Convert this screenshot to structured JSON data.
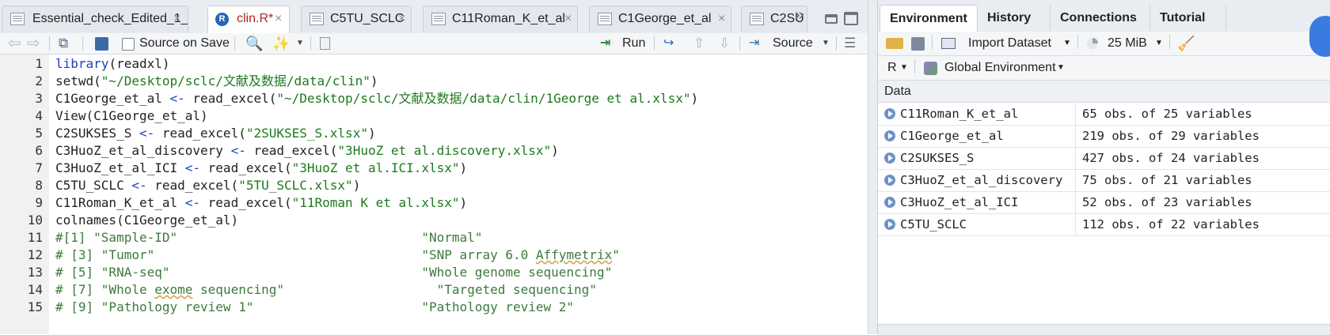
{
  "editor": {
    "tabs": [
      {
        "label": "Essential_check_Edited_1_",
        "icon": "document-icon",
        "active": false
      },
      {
        "label": "clin.R*",
        "icon": "r-script-icon",
        "active": true
      },
      {
        "label": "C5TU_SCLC",
        "icon": "document-icon",
        "active": false
      },
      {
        "label": "C11Roman_K_et_al",
        "icon": "document-icon",
        "active": false
      },
      {
        "label": "C1George_et_al",
        "icon": "document-icon",
        "active": false
      },
      {
        "label": "C2SU",
        "icon": "document-icon",
        "active": false
      }
    ],
    "toolbar": {
      "source_on_save": "Source on Save",
      "run": "Run",
      "source": "Source"
    },
    "lines": [
      {
        "n": "1",
        "parts": [
          [
            "kw",
            "library"
          ],
          [
            "",
            "(readxl)"
          ]
        ]
      },
      {
        "n": "2",
        "parts": [
          [
            "",
            "setwd("
          ],
          [
            "str",
            "\"~/Desktop/sclc/文献及数据/data/clin\""
          ],
          [
            "",
            ")"
          ]
        ]
      },
      {
        "n": "3",
        "parts": [
          [
            "",
            "C1George_et_al "
          ],
          [
            "op",
            "<-"
          ],
          [
            "",
            " read_excel("
          ],
          [
            "str",
            "\"~/Desktop/sclc/文献及数据/data/clin/1George et al.xlsx\""
          ],
          [
            "",
            ")"
          ]
        ]
      },
      {
        "n": "4",
        "parts": [
          [
            "",
            "View(C1George_et_al)"
          ]
        ]
      },
      {
        "n": "5",
        "parts": [
          [
            "",
            "C2SUKSES_S "
          ],
          [
            "op",
            "<-"
          ],
          [
            "",
            " read_excel("
          ],
          [
            "str",
            "\"2SUKSES_S.xlsx\""
          ],
          [
            "",
            ")"
          ]
        ]
      },
      {
        "n": "6",
        "parts": [
          [
            "",
            "C3HuoZ_et_al_discovery "
          ],
          [
            "op",
            "<-"
          ],
          [
            "",
            " read_excel("
          ],
          [
            "str",
            "\"3HuoZ et al.discovery.xlsx\""
          ],
          [
            "",
            ")"
          ]
        ]
      },
      {
        "n": "7",
        "parts": [
          [
            "",
            "C3HuoZ_et_al_ICI "
          ],
          [
            "op",
            "<-"
          ],
          [
            "",
            " read_excel("
          ],
          [
            "str",
            "\"3HuoZ et al.ICI.xlsx\""
          ],
          [
            "",
            ")"
          ]
        ]
      },
      {
        "n": "8",
        "parts": [
          [
            "",
            "C5TU_SCLC "
          ],
          [
            "op",
            "<-"
          ],
          [
            "",
            " read_excel("
          ],
          [
            "str",
            "\"5TU_SCLC.xlsx\""
          ],
          [
            "",
            ")"
          ]
        ]
      },
      {
        "n": "9",
        "parts": [
          [
            "",
            "C11Roman_K_et_al "
          ],
          [
            "op",
            "<-"
          ],
          [
            "",
            " read_excel("
          ],
          [
            "str",
            "\"11Roman K et al.xlsx\""
          ],
          [
            "",
            ")"
          ]
        ]
      },
      {
        "n": "10",
        "parts": [
          [
            "",
            "colnames(C1George_et_al)"
          ]
        ]
      },
      {
        "n": "11",
        "parts": [
          [
            "cm",
            "#[1] \"Sample-ID\"                                \"Normal\""
          ]
        ]
      },
      {
        "n": "12",
        "parts": [
          [
            "cm",
            "# [3] \"Tumor\"                                   \"SNP array 6.0 "
          ],
          [
            "cm sq",
            "Affymetrix"
          ],
          [
            "cm",
            "\""
          ]
        ]
      },
      {
        "n": "13",
        "parts": [
          [
            "cm",
            "# [5] \"RNA-seq\"                                 \"Whole genome sequencing\""
          ]
        ]
      },
      {
        "n": "14",
        "parts": [
          [
            "cm",
            "# [7] \"Whole "
          ],
          [
            "cm sq",
            "exome"
          ],
          [
            "cm",
            " sequencing\"                    \"Targeted sequencing\""
          ]
        ]
      },
      {
        "n": "15",
        "parts": [
          [
            "cm",
            "# [9] \"Pathology review 1\"                      \"Pathology review 2\""
          ]
        ]
      }
    ]
  },
  "env": {
    "tabs": [
      "Environment",
      "History",
      "Connections",
      "Tutorial"
    ],
    "import_dataset": "Import Dataset",
    "memory": "25 MiB",
    "language": "R",
    "scope": "Global Environment",
    "data_header": "Data",
    "rows": [
      {
        "name": "C11Roman_K_et_al",
        "value": "65 obs. of 25 variables"
      },
      {
        "name": "C1George_et_al",
        "value": "219 obs. of 29 variables"
      },
      {
        "name": "C2SUKSES_S",
        "value": "427 obs. of 24 variables"
      },
      {
        "name": "C3HuoZ_et_al_discovery",
        "value": "75 obs. of 21 variables"
      },
      {
        "name": "C3HuoZ_et_al_ICI",
        "value": "52 obs. of 23 variables"
      },
      {
        "name": "C5TU_SCLC",
        "value": "112 obs. of 22 variables"
      }
    ]
  }
}
